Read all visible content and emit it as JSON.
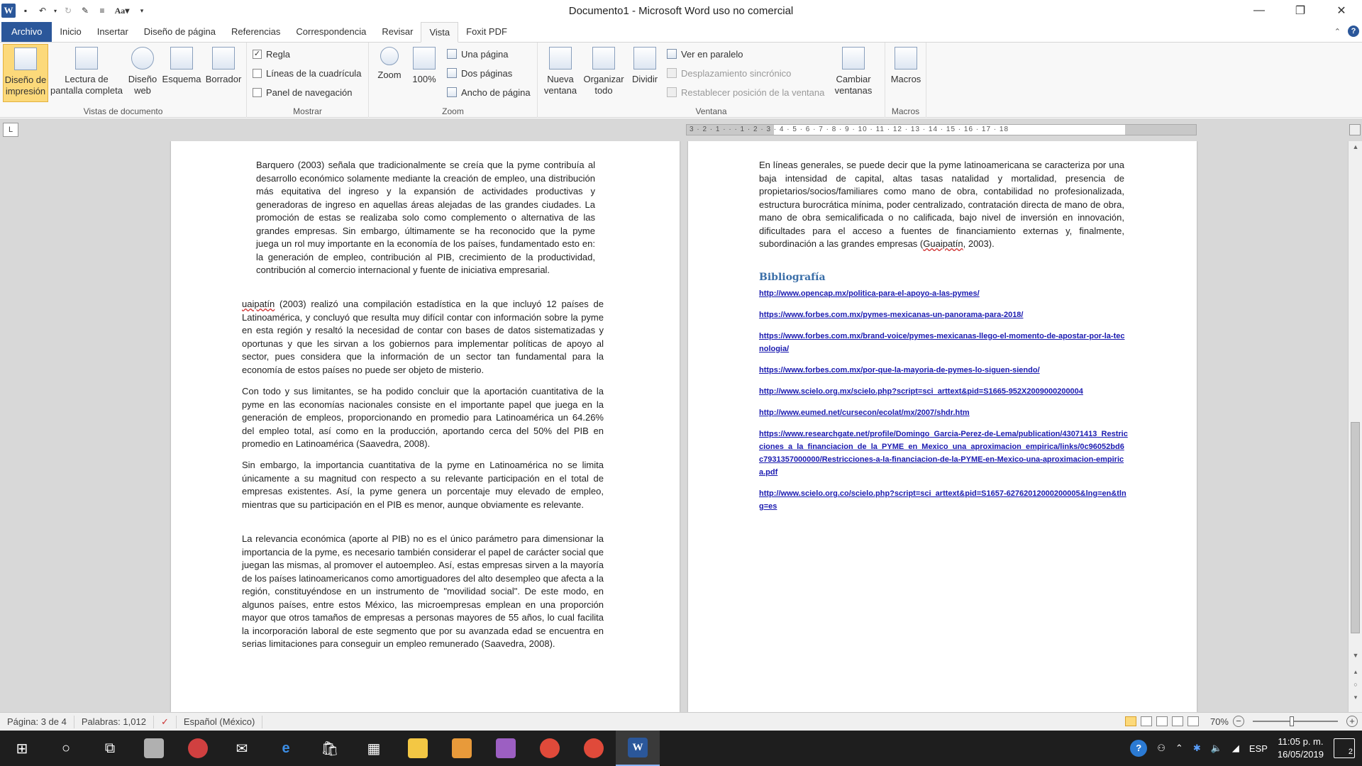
{
  "app": {
    "title": "Documento1 - Microsoft Word uso no comercial",
    "logo_letter": "W"
  },
  "qat": {
    "font_size_glyph": "Aa"
  },
  "tabs": [
    {
      "label": "Archivo"
    },
    {
      "label": "Inicio"
    },
    {
      "label": "Insertar"
    },
    {
      "label": "Diseño de página"
    },
    {
      "label": "Referencias"
    },
    {
      "label": "Correspondencia"
    },
    {
      "label": "Revisar"
    },
    {
      "label": "Vista"
    },
    {
      "label": "Foxit PDF"
    }
  ],
  "ribbon": {
    "vistas": {
      "label": "Vistas de documento",
      "btn_print": "Diseño de impresión",
      "btn_reading": "Lectura de pantalla completa",
      "btn_web": "Diseño web",
      "btn_outline": "Esquema",
      "btn_draft": "Borrador"
    },
    "mostrar": {
      "label": "Mostrar",
      "regla": "Regla",
      "cuadricula": "Líneas de la cuadrícula",
      "navegacion": "Panel de navegación",
      "regla_checked": true
    },
    "zoom": {
      "label": "Zoom",
      "btn_zoom": "Zoom",
      "btn_100": "100%",
      "una_pagina": "Una página",
      "dos_paginas": "Dos páginas",
      "ancho": "Ancho de página"
    },
    "ventana": {
      "label": "Ventana",
      "nueva": "Nueva ventana",
      "organizar": "Organizar todo",
      "dividir": "Dividir",
      "paralelo": "Ver en paralelo",
      "sincronico": "Desplazamiento sincrónico",
      "restablecer": "Restablecer posición de la ventana",
      "cambiar": "Cambiar ventanas"
    },
    "macros": {
      "label": "Macros",
      "btn": "Macros"
    }
  },
  "ruler": {
    "ticks": "3 · 2 · 1 · · · 1 · 2 · 3 · 4 · 5 · 6 · 7 · 8 · 9 · 10 · 11 · 12 · 13 · 14 · 15 · 16 · 17 · 18"
  },
  "page1": {
    "quote": "Barquero (2003) señala que tradicionalmente se creía que la pyme contribuía al desarrollo económico solamente mediante la creación de empleo, una distribución más equitativa del ingreso y la expansión de actividades productivas y generadoras de ingreso en aquellas áreas alejadas de las grandes ciudades. La promoción de estas se realizaba solo como complemento o alternativa de las grandes empresas. Sin embargo, últimamente se ha reconocido que la pyme juega un rol muy importante en la economía de los países, fundamentado esto en: la generación de empleo, contribución al PIB, crecimiento de la productividad, contribución al comercio internacional y fuente de iniciativa empresarial.",
    "p2_name": "uaipatín",
    "p2_rest": " (2003) realizó una compilación estadística en la que incluyó 12 países de Latinoamérica, y concluyó que resulta muy difícil contar con información sobre la pyme en esta región y resaltó la necesidad de contar con bases de datos sistematizadas y oportunas y que les sirvan a los gobiernos para implementar políticas de apoyo al sector, pues considera que la información de un sector tan fundamental para la economía de estos países no puede ser objeto de misterio.",
    "p3": "Con todo y sus limitantes, se ha podido concluir que la aportación cuantitativa de la pyme en las economías nacionales consiste en el importante papel que juega en la generación de empleos, proporcionando en promedio para Latinoamérica un 64.26% del empleo total, así como en la producción, aportando cerca del 50% del PIB en promedio en Latinoamérica (Saavedra, 2008).",
    "p4": "Sin embargo, la importancia cuantitativa de la pyme en Latinoamérica no se limita únicamente a su magnitud con respecto a su relevante participación en el total de empresas existentes. Así, la pyme genera un porcentaje muy elevado de empleo, mientras que su participación en el PIB es menor, aunque obviamente es relevante.",
    "p5": "La relevancia económica (aporte al PIB) no es el único parámetro para dimensionar la importancia de la pyme, es necesario también considerar el papel de carácter social que juegan las mismas, al promover el autoempleo. Así, estas empresas sirven a la mayoría de los países latinoamericanos como amortiguadores del alto desempleo que afecta a la región, constituyéndose en un instrumento de \"movilidad social\". De este modo, en algunos países, entre estos México, las microempresas emplean en una proporción mayor que otros tamaños de empresas a personas mayores de 55 años, lo cual facilita la incorporación laboral de este segmento que por su avanzada edad se encuentra en serias limitaciones para conseguir un empleo remunerado (Saavedra, 2008)."
  },
  "page2": {
    "p1_a": "En líneas generales, se puede decir que la pyme latinoamericana se caracteriza por una baja intensidad de capital, altas tasas natalidad y mortalidad, presencia de propietarios/socios/familiares como mano de obra, contabilidad no profesionalizada, estructura burocrática mínima, poder centralizado, contratación directa de mano de obra, mano de obra semicalificada o no calificada, bajo nivel de inversión en innovación, dificultades para el acceso a fuentes de financiamiento externas y, finalmente, subordinación a las grandes empresas (",
    "p1_name": "Guaipatín",
    "p1_b": ", 2003).",
    "biblio_heading": "Bibliografía",
    "links": [
      "http://www.opencap.mx/politica-para-el-apoyo-a-las-pymes/",
      "https://www.forbes.com.mx/pymes-mexicanas-un-panorama-para-2018/",
      "https://www.forbes.com.mx/brand-voice/pymes-mexicanas-llego-el-momento-de-apostar-por-la-tecnologia/",
      "https://www.forbes.com.mx/por-que-la-mayoria-de-pymes-lo-siguen-siendo/",
      "http://www.scielo.org.mx/scielo.php?script=sci_arttext&pid=S1665-952X2009000200004",
      "http://www.eumed.net/cursecon/ecolat/mx/2007/shdr.htm",
      "https://www.researchgate.net/profile/Domingo_Garcia-Perez-de-Lema/publication/43071413_Restricciones_a_la_financiacion_de_la_PYME_en_Mexico_una_aproximacion_empirica/links/0c96052bd6c7931357000000/Restricciones-a-la-financiacion-de-la-PYME-en-Mexico-una-aproximacion-empirica.pdf",
      "http://www.scielo.org.co/scielo.php?script=sci_arttext&pid=S1657-62762012000200005&lng=en&tlng=es"
    ]
  },
  "status": {
    "page": "Página: 3 de 4",
    "words": "Palabras: 1,012",
    "lang": "Español (México)",
    "zoom": "70%"
  },
  "taskbar": {
    "lang": "ESP",
    "time": "11:05 p. m.",
    "date": "16/05/2019",
    "notif_count": "2"
  },
  "colors": {
    "word_blue": "#2b579a",
    "selected_gold": "#fcd97a",
    "link_blue": "#1a1ab0",
    "heading_blue": "#3a6ea8"
  }
}
